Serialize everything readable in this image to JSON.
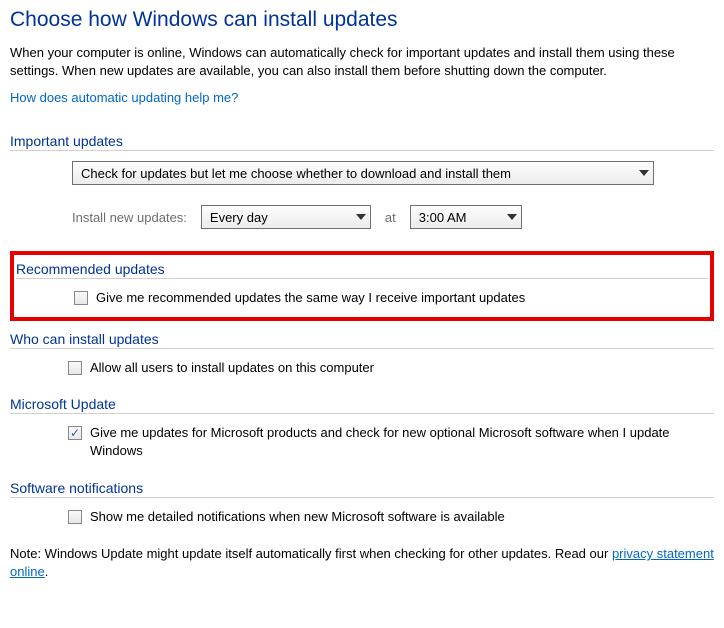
{
  "title": "Choose how Windows can install updates",
  "intro": "When your computer is online, Windows can automatically check for important updates and install them using these settings. When new updates are available, you can also install them before shutting down the computer.",
  "help_link": "How does automatic updating help me?",
  "sections": {
    "important": {
      "header": "Important updates",
      "dropdown_value": "Check for updates but let me choose whether to download and install them",
      "schedule_label": "Install new updates:",
      "frequency": "Every day",
      "at_label": "at",
      "time": "3:00 AM"
    },
    "recommended": {
      "header": "Recommended updates",
      "checkbox_label": "Give me recommended updates the same way I receive important updates",
      "checked": false
    },
    "who": {
      "header": "Who can install updates",
      "checkbox_label": "Allow all users to install updates on this computer",
      "checked": false
    },
    "msupdate": {
      "header": "Microsoft Update",
      "checkbox_label": "Give me updates for Microsoft products and check for new optional Microsoft software when I update Windows",
      "checked": true
    },
    "notifications": {
      "header": "Software notifications",
      "checkbox_label": "Show me detailed notifications when new Microsoft software is available",
      "checked": false
    }
  },
  "note_prefix": "Note: Windows Update might update itself automatically first when checking for other updates.  Read our ",
  "privacy_link": "privacy statement online",
  "note_suffix": "."
}
